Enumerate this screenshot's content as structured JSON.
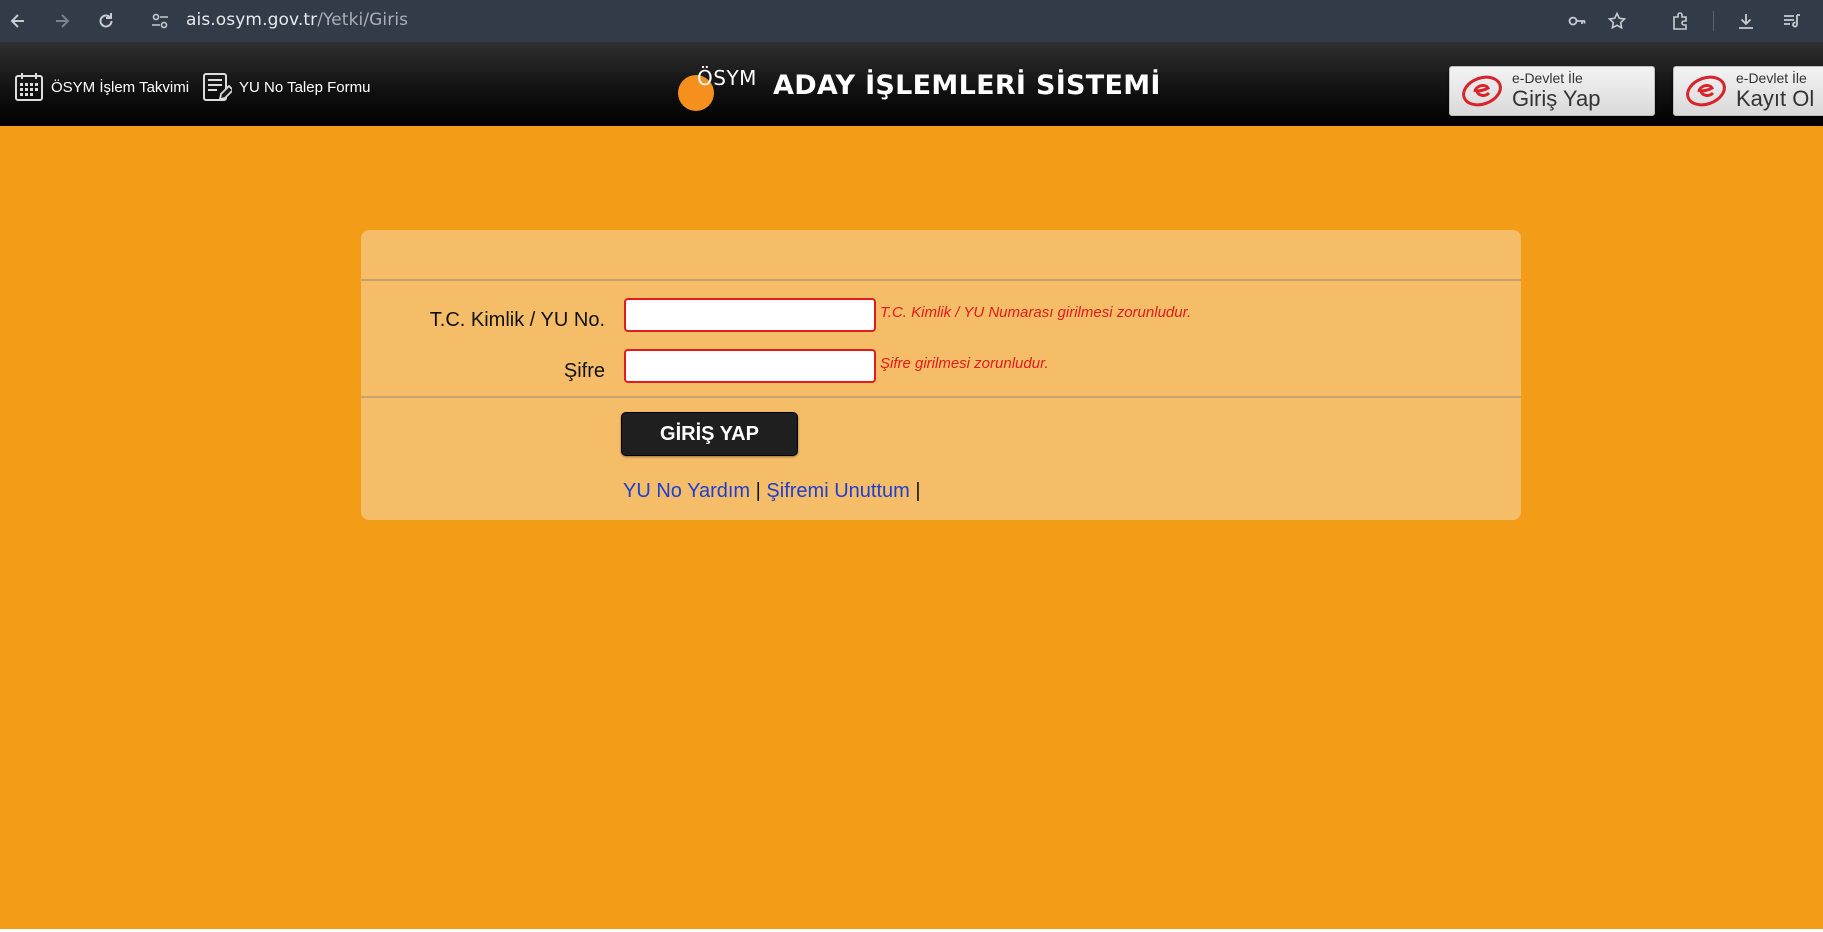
{
  "browser": {
    "url_host": "ais.osym.gov.tr",
    "url_path": "/Yetki/Giris",
    "icons": [
      "back-arrow-icon",
      "forward-arrow-icon",
      "reload-icon",
      "site-settings-icon",
      "key-icon",
      "star-icon",
      "extensions-icon",
      "download-icon",
      "reading-list-icon"
    ]
  },
  "header": {
    "calendar_link": "ÖSYM İşlem Takvimi",
    "form_link": "YU No Talep Formu",
    "logo_text": "ÖSYM",
    "system_title": "ADAY İŞLEMLERİ SİSTEMİ",
    "edevlet_login": {
      "small": "e-Devlet İle",
      "big": "Giriş Yap"
    },
    "edevlet_register": {
      "small": "e-Devlet İle",
      "big": "Kayıt Ol"
    }
  },
  "login": {
    "id_label": "T.C. Kimlik / YU No.",
    "id_value": "",
    "id_error": "T.C. Kimlik / YU Numarası girilmesi zorunludur.",
    "password_label": "Şifre",
    "password_value": "",
    "password_error": "Şifre girilmesi zorunludur.",
    "submit_label": "GİRİŞ YAP",
    "help_link": "YU No Yardım",
    "separator": "|",
    "forgot_link": "Şifremi Unuttum"
  },
  "colors": {
    "page_bg": "#f39c18",
    "panel_bg": "#f6bd69",
    "error": "#e21b1b",
    "link": "#1d3fd1",
    "logo_accent": "#f5901e"
  }
}
